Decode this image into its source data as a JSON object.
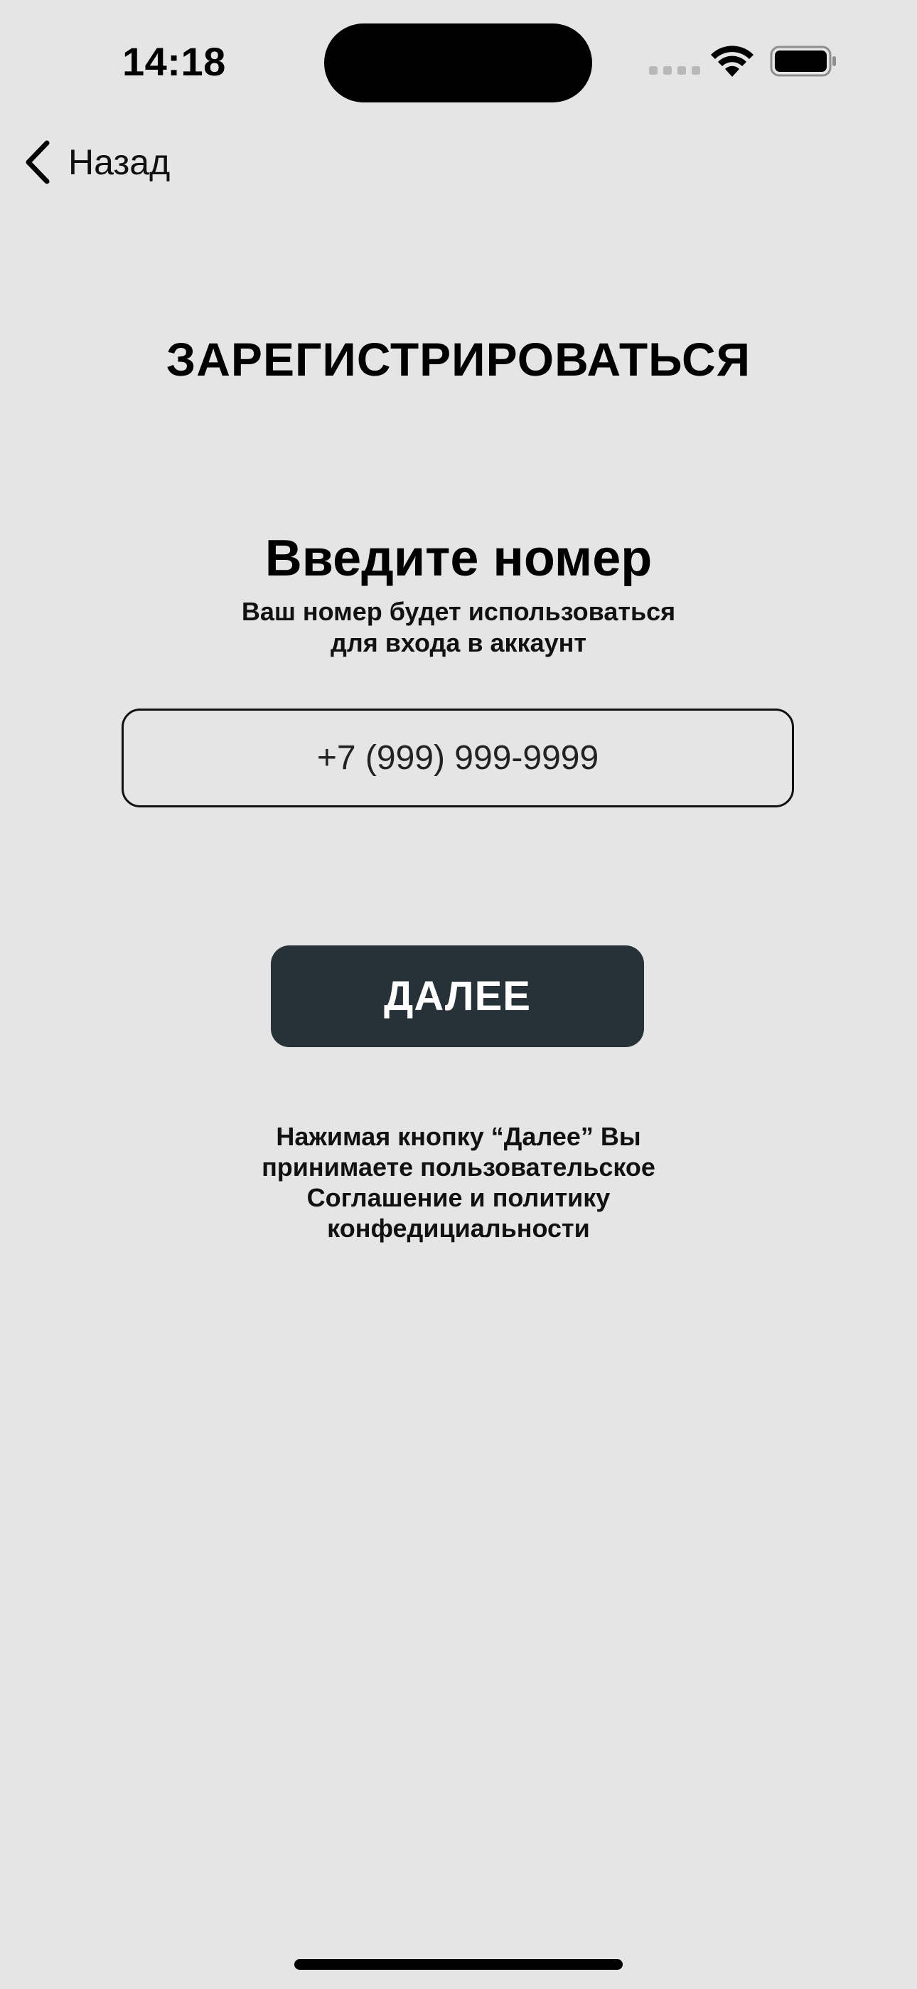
{
  "status_bar": {
    "time": "14:18",
    "icons": [
      "cellular-signal-icon",
      "wifi-icon",
      "battery-icon"
    ]
  },
  "nav": {
    "back_label": "Назад",
    "back_icon": "chevron-left-icon"
  },
  "screen": {
    "title": "ЗАРЕГИСТРИРОВАТЬСЯ",
    "heading": "Введите номер",
    "subheading_lines": [
      "Ваш номер будет использоваться",
      "для входа в аккаунт"
    ]
  },
  "phone_input": {
    "placeholder": "+7 (999) 999-9999",
    "value": ""
  },
  "next_button": {
    "label": "ДАЛЕЕ"
  },
  "terms": {
    "lines": [
      "Нажимая кнопку “Далее” Вы",
      "принимаете пользовательское",
      "Соглашение и политику",
      "конфедициальности"
    ]
  },
  "colors": {
    "background": "#E5E5E5",
    "button_background": "#263238",
    "button_text": "#FFFFFF",
    "text": "#000000"
  }
}
